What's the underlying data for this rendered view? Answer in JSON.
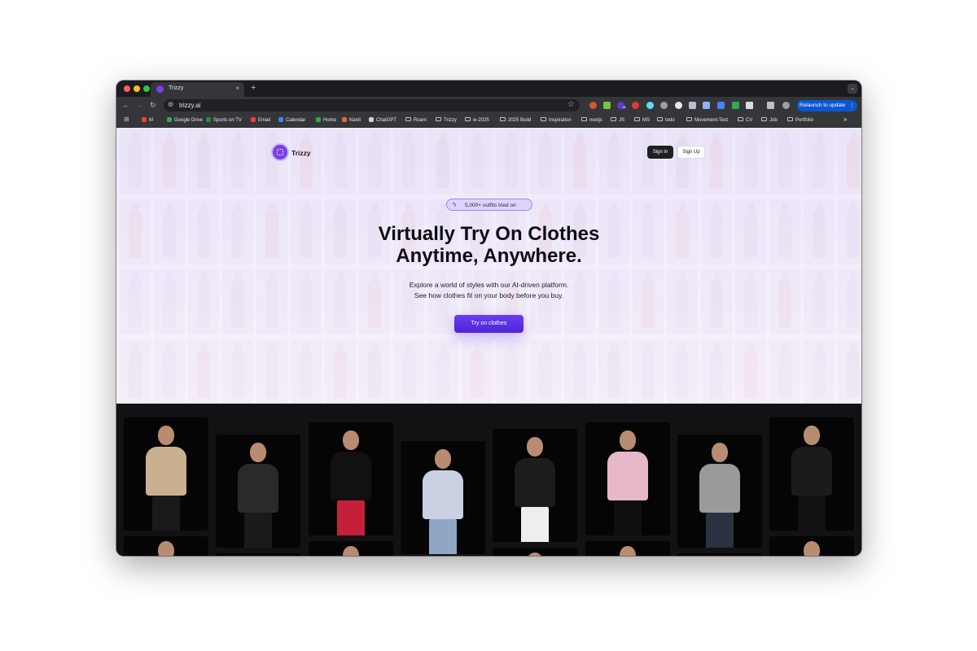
{
  "browser": {
    "tab_title": "Trizzy",
    "tab_close": "×",
    "new_tab": "+",
    "tab_menu": "⌄",
    "url": "trizzy.ai",
    "relaunch_label": "Relaunch to update",
    "relaunch_more": "⋮",
    "bookmarks": [
      {
        "label": "M",
        "icon": "gmail-icon",
        "color": "#ea4335"
      },
      {
        "label": "Google Drive",
        "icon": "drive-icon",
        "color": "#34a853"
      },
      {
        "label": "Sports on TV",
        "icon": "sports-icon",
        "color": "#1e8e3e"
      },
      {
        "label": "Email",
        "icon": "gmail-icon",
        "color": "#ea4335"
      },
      {
        "label": "Calendar",
        "icon": "calendar-icon",
        "color": "#4285f4"
      },
      {
        "label": "Home",
        "icon": "maps-icon",
        "color": "#34a853"
      },
      {
        "label": "Nanit",
        "icon": "nanit-icon",
        "color": "#e8663d"
      },
      {
        "label": "ChatGPT",
        "icon": "chatgpt-icon",
        "color": "#d0d0d0"
      },
      {
        "label": "Roam",
        "icon": "folder-icon"
      },
      {
        "label": "Trizzy",
        "icon": "folder-icon"
      },
      {
        "label": "w-2025",
        "icon": "folder-icon"
      },
      {
        "label": "2025 Build",
        "icon": "folder-icon"
      },
      {
        "label": "Inspiration",
        "icon": "folder-icon"
      },
      {
        "label": "nextjs",
        "icon": "folder-icon"
      },
      {
        "label": "JS",
        "icon": "folder-icon"
      },
      {
        "label": "MS",
        "icon": "folder-icon"
      },
      {
        "label": "todo",
        "icon": "folder-icon"
      },
      {
        "label": "Movement-Test",
        "icon": "folder-icon"
      },
      {
        "label": "CV",
        "icon": "folder-icon"
      },
      {
        "label": "Job",
        "icon": "folder-icon"
      },
      {
        "label": "Portfolio",
        "icon": "folder-icon"
      }
    ],
    "bookmarks_overflow": "»",
    "extension_badge": "16"
  },
  "page": {
    "brand": "Trizzy",
    "sign_in": "Sign in",
    "sign_up": "Sign Up",
    "badge": "5,000+ outfits tried on",
    "title_line1": "Virtually Try On Clothes",
    "title_line2": "Anytime, Anywhere.",
    "subtitle_line1": "Explore a world of styles with our AI-driven platform.",
    "subtitle_line2": "See how clothes fit on your body before you buy.",
    "cta": "Try on clothes",
    "accent_color": "#6a3df0"
  },
  "gallery": [
    {
      "name": "model-man-trench-coat",
      "top": "#c9b08f",
      "bottom": "#1a1a1a"
    },
    {
      "name": "model-man-graphic-tee",
      "top": "#2a2a2a",
      "bottom": "#1a1a1a"
    },
    {
      "name": "model-woman-red-pants",
      "top": "#111111",
      "bottom": "#c51f3a"
    },
    {
      "name": "model-woman-gray-hoodie",
      "top": "#c9d1e2",
      "bottom": "#8fa6c5"
    },
    {
      "name": "model-man-black-sweater",
      "top": "#1c1c1c",
      "bottom": "#eeeeee"
    },
    {
      "name": "model-woman-pink-top",
      "top": "#e7b8c9",
      "bottom": "#0f0f0f"
    },
    {
      "name": "model-man-gray-tee",
      "top": "#9a9a9a",
      "bottom": "#2a3140"
    },
    {
      "name": "model-man-leather-jacket",
      "top": "#1b1b1b",
      "bottom": "#111111"
    }
  ]
}
